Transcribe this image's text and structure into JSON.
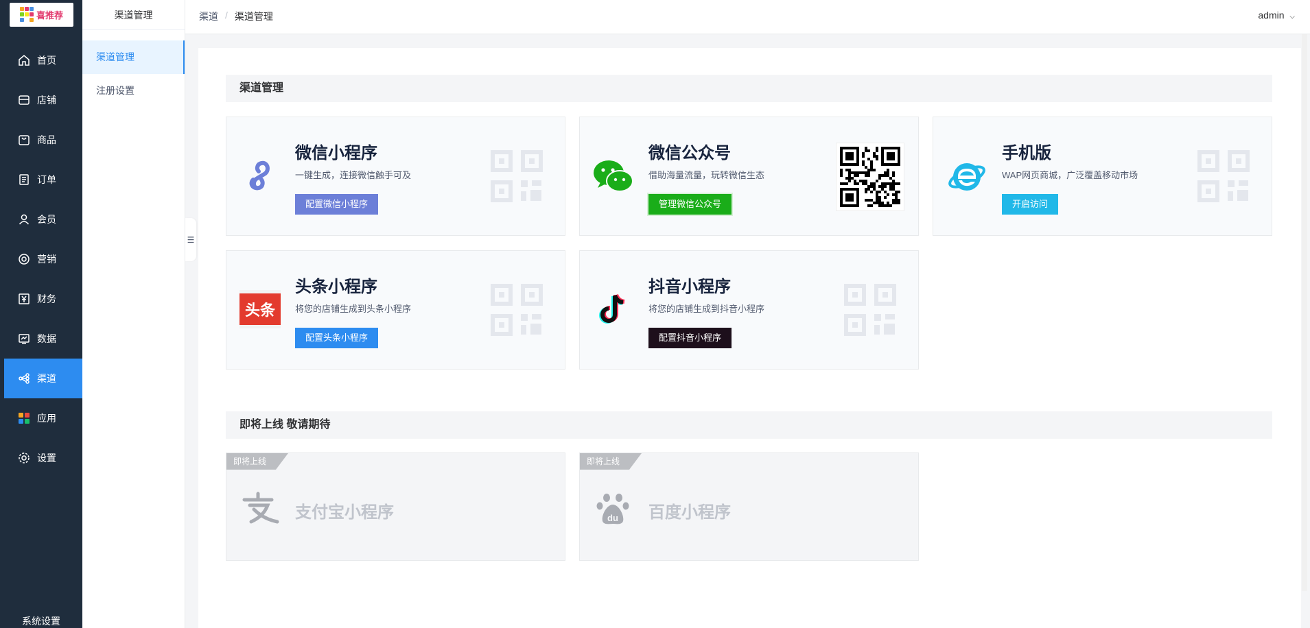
{
  "app": {
    "logo_text": "喜推荐"
  },
  "nav": {
    "items": [
      {
        "label": "首页",
        "icon": "home-icon"
      },
      {
        "label": "店铺",
        "icon": "store-icon"
      },
      {
        "label": "商品",
        "icon": "goods-icon"
      },
      {
        "label": "订单",
        "icon": "order-icon"
      },
      {
        "label": "会员",
        "icon": "member-icon"
      },
      {
        "label": "营销",
        "icon": "marketing-icon"
      },
      {
        "label": "财务",
        "icon": "finance-icon"
      },
      {
        "label": "数据",
        "icon": "data-icon"
      },
      {
        "label": "渠道",
        "icon": "channel-icon"
      },
      {
        "label": "应用",
        "icon": "apps-icon"
      },
      {
        "label": "设置",
        "icon": "settings-icon"
      }
    ],
    "active": "渠道",
    "footer": "系统设置"
  },
  "subnav": {
    "title": "渠道管理",
    "items": [
      "渠道管理",
      "注册设置"
    ]
  },
  "header": {
    "breadcrumb": [
      "渠道",
      "渠道管理"
    ],
    "user": "admin"
  },
  "sections": {
    "manage_title": "渠道管理",
    "soon_title": "即将上线 敬请期待"
  },
  "cards": [
    {
      "title": "微信小程序",
      "desc": "一键生成，连接微信触手可及",
      "button": "配置微信小程序",
      "color": "#6c7fd8"
    },
    {
      "title": "微信公众号",
      "desc": "借助海量流量，玩转微信生态",
      "button": "管理微信公众号",
      "color": "#1aad19"
    },
    {
      "title": "手机版",
      "desc": "WAP网页商城，广泛覆盖移动市场",
      "button": "开启访问",
      "color": "#21b8e8"
    },
    {
      "title": "头条小程序",
      "desc": "将您的店铺生成到头条小程序",
      "button": "配置头条小程序",
      "color": "#2d8cf0"
    },
    {
      "title": "抖音小程序",
      "desc": "将您的店铺生成到抖音小程序",
      "button": "配置抖音小程序",
      "color": "#1d0f1b"
    }
  ],
  "toutiao_logo_text": "头条",
  "baidu_logo_text": "du",
  "soon_cards": [
    {
      "ribbon": "即将上线",
      "title": "支付宝小程序"
    },
    {
      "ribbon": "即将上线",
      "title": "百度小程序"
    }
  ]
}
